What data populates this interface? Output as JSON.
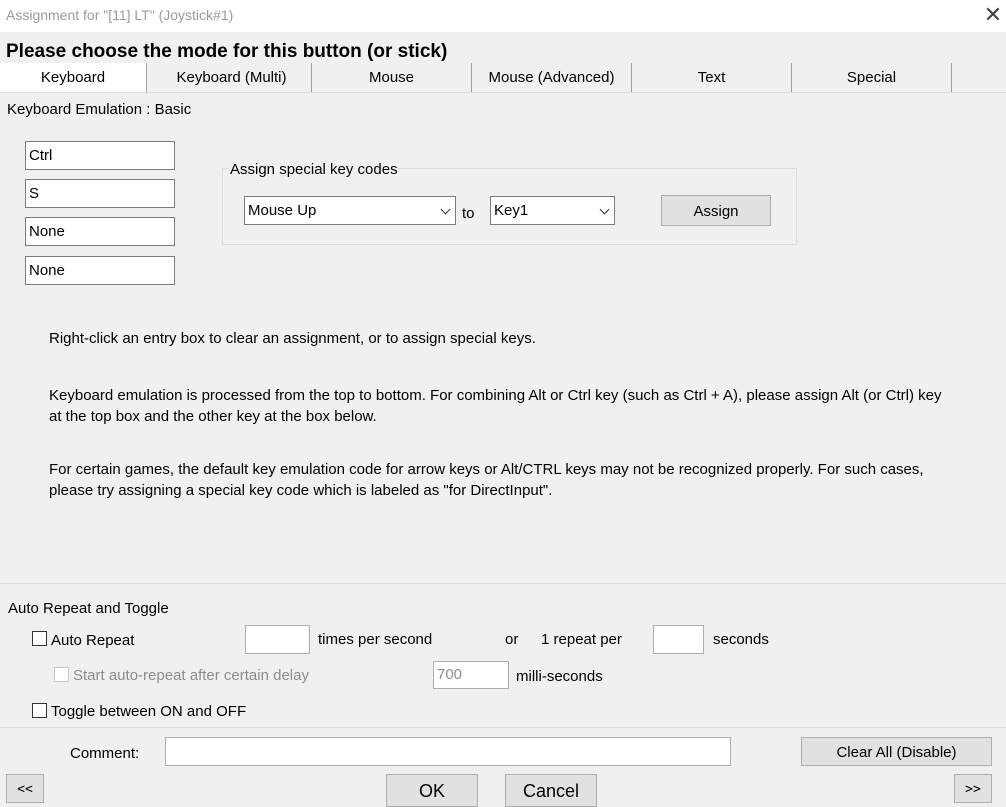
{
  "window": {
    "title": "Assignment for \"[11] LT\" (Joystick#1)",
    "close_glyph": "✕"
  },
  "heading": "Please choose the mode for this button (or stick)",
  "tabs": [
    {
      "label": "Keyboard",
      "active": true
    },
    {
      "label": "Keyboard (Multi)",
      "active": false
    },
    {
      "label": "Mouse",
      "active": false
    },
    {
      "label": "Mouse (Advanced)",
      "active": false
    },
    {
      "label": "Text",
      "active": false
    },
    {
      "label": "Special",
      "active": false
    }
  ],
  "emulation_label": "Keyboard Emulation : Basic",
  "key_entries": [
    "Ctrl",
    "S",
    "None",
    "None"
  ],
  "special_keys": {
    "group_title": "Assign special key codes",
    "source_value": "Mouse Up",
    "to_label": "to",
    "target_value": "Key1",
    "assign_label": "Assign"
  },
  "messages": [
    "Right-click an entry box to clear an assignment, or to assign special keys.",
    "Keyboard emulation is processed from the top to bottom.  For combining Alt or Ctrl key (such as Ctrl + A), please assign Alt (or Ctrl) key at the top box and the other key at the box below.",
    "For certain games, the default key emulation code for arrow keys or Alt/CTRL keys may not be recognized properly.  For such cases, please try assigning a special key code which is labeled as \"for DirectInput\"."
  ],
  "auto_repeat": {
    "section_title": "Auto Repeat and Toggle",
    "auto_repeat_label": "Auto Repeat",
    "times_value": "",
    "times_label": "times per second",
    "or_label": "or",
    "repeat_per_label": "1 repeat per",
    "seconds_value": "",
    "seconds_label": "seconds",
    "delay_label": "Start auto-repeat after certain delay",
    "delay_value": "700",
    "delay_unit": "milli-seconds",
    "toggle_label": "Toggle between ON and OFF"
  },
  "footer": {
    "comment_label": "Comment:",
    "comment_value": "",
    "clear_all_label": "Clear All (Disable)",
    "prev_label": "<<",
    "ok_label": "OK",
    "cancel_label": "Cancel",
    "next_label": ">>"
  }
}
